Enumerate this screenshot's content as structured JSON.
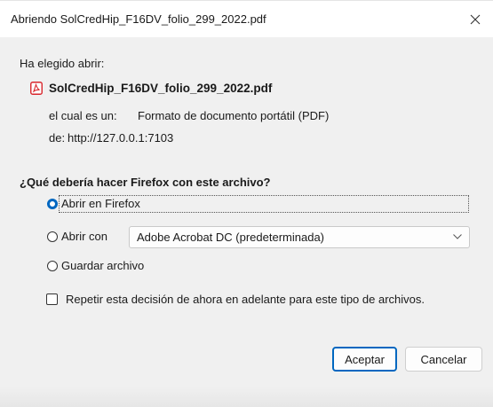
{
  "window": {
    "title": "Abriendo SolCredHip_F16DV_folio_299_2022.pdf",
    "close_glyph": "✕"
  },
  "file": {
    "intro": "Ha elegido abrir:",
    "icon": "pdf-file-icon",
    "name": "SolCredHip_F16DV_folio_299_2022.pdf",
    "type_label": "el cual es un:",
    "type_value": "Formato de documento portátil (PDF)",
    "from_label": "de:",
    "from_value": "http://127.0.0.1:7103"
  },
  "question": "¿Qué debería hacer Firefox con este archivo?",
  "options": {
    "open_in_firefox": {
      "label": "Abrir en Firefox",
      "checked": true
    },
    "open_with": {
      "label": "Abrir con",
      "checked": false
    },
    "save_file": {
      "label": "Guardar archivo",
      "checked": false
    }
  },
  "app_select": {
    "value": "Adobe Acrobat DC (predeterminada)"
  },
  "remember": {
    "label": "Repetir esta decisión de ahora en adelante para este tipo de archivos.",
    "checked": false
  },
  "buttons": {
    "accept": "Aceptar",
    "cancel": "Cancelar"
  },
  "colors": {
    "accent": "#0067c0",
    "pdf_red": "#d8262c"
  }
}
